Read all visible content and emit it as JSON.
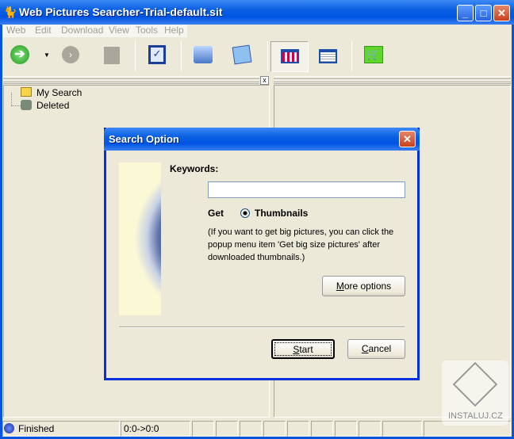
{
  "window": {
    "title": "Web Pictures Searcher-Trial-default.sit",
    "minimize": "_",
    "maximize": "□",
    "close": "✕"
  },
  "menu": [
    "Web",
    "Edit",
    "Download",
    "View",
    "Tools",
    "Help"
  ],
  "toolbar": [
    "go-icon",
    "dropdown-arrow-icon",
    "forward-icon",
    "stop-icon",
    "edit-check-icon",
    "computer-icon",
    "map-icon",
    "thumbnail-view-icon",
    "list-view-icon",
    "cart-icon"
  ],
  "tree": {
    "items": [
      {
        "label": "My Search"
      },
      {
        "label": "Deleted"
      }
    ],
    "close": "x"
  },
  "dialog": {
    "title": "Search Option",
    "close": "✕",
    "keywords_label": "Keywords:",
    "keywords_value": "",
    "get_label": "Get",
    "radio_label": "Thumbnails",
    "note": "(If you want to get big pictures, you can click the popup menu item 'Get big size pictures' after downloaded thumbnails.)",
    "more_options_u": "M",
    "more_options_rest": "ore options",
    "start_u": "S",
    "start_rest": "tart",
    "cancel_u": "C",
    "cancel_rest": "ancel"
  },
  "status": {
    "text": "Finished",
    "range": "0:0->0:0"
  },
  "watermark": "INSTALUJ.CZ",
  "colors": {
    "titlebar": "#0054e3",
    "face": "#ece9d8"
  }
}
